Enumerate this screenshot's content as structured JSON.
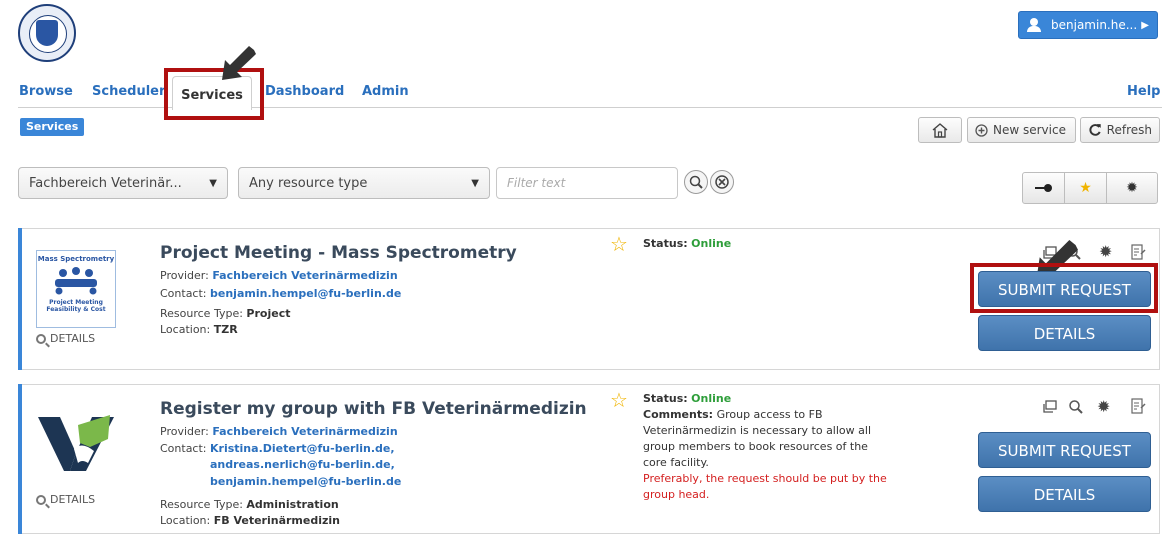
{
  "header": {
    "user_name": "benjamin.he...",
    "help": "Help"
  },
  "nav": {
    "tabs": [
      "Browse",
      "Scheduler",
      "Services",
      "Dashboard",
      "Admin"
    ]
  },
  "toolbar": {
    "badge": "Services",
    "new_service": "New service",
    "refresh": "Refresh"
  },
  "filters": {
    "provider": "Fachbereich Veterinär...",
    "resource_type": "Any resource type",
    "filter_placeholder": "Filter text"
  },
  "services": [
    {
      "title": "Project Meeting - Mass Spectrometry",
      "provider_label": "Provider:",
      "provider": "Fachbereich Veterinärmedizin",
      "contact_label": "Contact:",
      "contacts": [
        "benjamin.hempel@fu-berlin.de"
      ],
      "resource_type_label": "Resource Type:",
      "resource_type": "Project",
      "location_label": "Location:",
      "location": "TZR",
      "status_label": "Status:",
      "status": "Online",
      "thumb_line1": "Mass Spectrometry",
      "thumb_line2": "Project Meeting",
      "thumb_line3": "Feasibility & Cost",
      "details_link": "DETAILS",
      "submit": "SUBMIT REQUEST",
      "details": "DETAILS"
    },
    {
      "title": "Register my group with FB Veterinärmedizin",
      "provider_label": "Provider:",
      "provider": "Fachbereich Veterinärmedizin",
      "contact_label": "Contact:",
      "contacts": [
        "Kristina.Dietert@fu-berlin.de,",
        "andreas.nerlich@fu-berlin.de,",
        "benjamin.hempel@fu-berlin.de"
      ],
      "resource_type_label": "Resource Type:",
      "resource_type": "Administration",
      "location_label": "Location:",
      "location": "FB Veterinärmedizin",
      "status_label": "Status:",
      "status": "Online",
      "comments_label": "Comments:",
      "comments": [
        "Group access to FB",
        "Veterinärmedizin is necessary to allow all",
        "group members to book resources of the",
        "core facility."
      ],
      "warning": [
        "Preferably, the request should be put by the",
        "group head."
      ],
      "details_link": "DETAILS",
      "submit": "SUBMIT REQUEST",
      "details": "DETAILS"
    }
  ],
  "colors": {
    "accent": "#3a86d8",
    "highlight": "#b01010",
    "online": "#2e9e3a",
    "button": "#4a7fb7"
  }
}
